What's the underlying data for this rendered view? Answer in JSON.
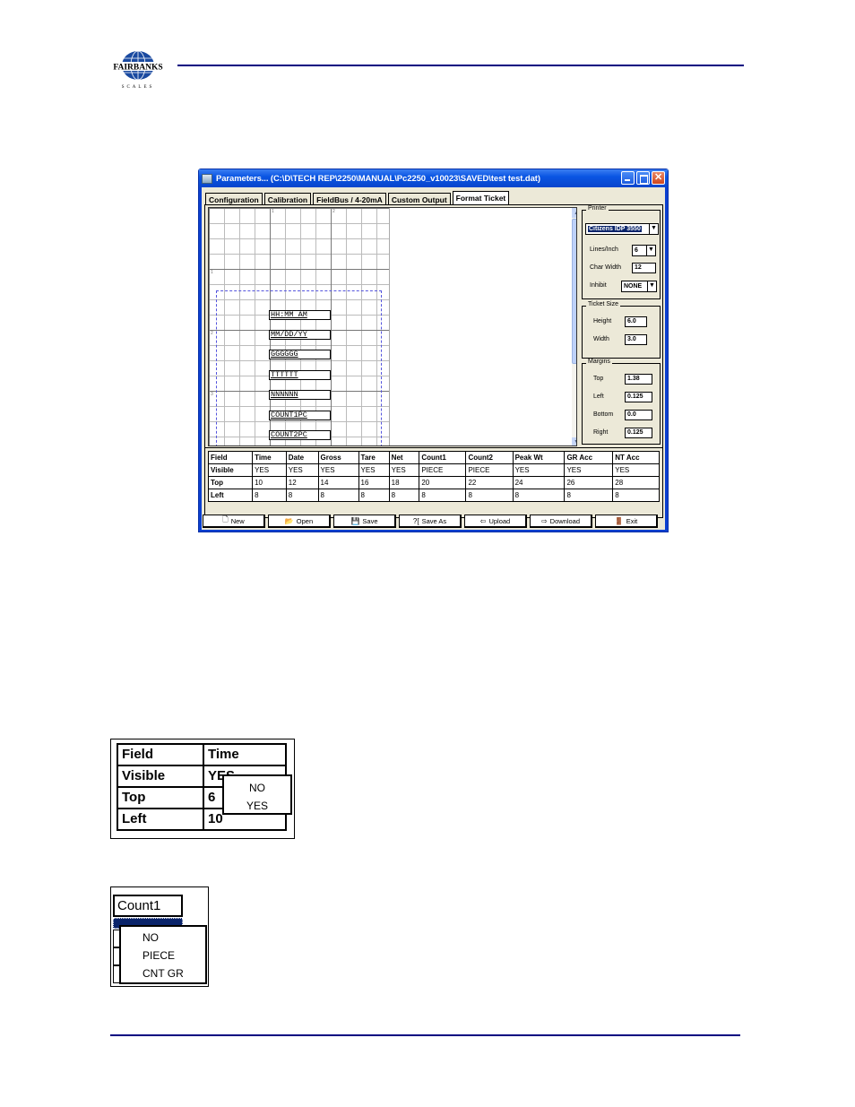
{
  "document": {
    "logo": {
      "brand": "FAIRBANKS",
      "sub": "SCALES"
    },
    "accent_color": "#000080"
  },
  "window": {
    "title": "Parameters... (C:\\D\\TECH REP\\2250\\MANUAL\\Pc2250_v10023\\SAVED\\test test.dat)",
    "controls": [
      "minimize",
      "maximize",
      "close"
    ],
    "tabs": [
      {
        "label": "Configuration",
        "active": false
      },
      {
        "label": "Calibration",
        "active": false
      },
      {
        "label": "FieldBus / 4-20mA",
        "active": false
      },
      {
        "label": "Custom Output",
        "active": false
      },
      {
        "label": "Format Ticket",
        "active": true
      }
    ],
    "canvas": {
      "ruler_top": [
        "1",
        "2"
      ],
      "ruler_left": [
        "1",
        "2",
        "3"
      ],
      "fields": [
        "HH:MM AM",
        "MM/DD/YY",
        "GGGGGG",
        "TTTTTT",
        "NNNNNN",
        "COUNT1PC",
        "COUNT2PC"
      ]
    },
    "printer": {
      "group_label": "Printer",
      "model": "Citizens IDP 3550",
      "lines_per_inch_label": "Lines/Inch",
      "lines_per_inch": "6",
      "char_width_label": "Char Width",
      "char_width": "12",
      "inhibit_label": "Inhibit",
      "inhibit": "NONE"
    },
    "ticket_size": {
      "group_label": "Ticket Size",
      "height_label": "Height",
      "height": "6.0",
      "width_label": "Width",
      "width": "3.0"
    },
    "margins": {
      "group_label": "Margins",
      "top_label": "Top",
      "top": "1.38",
      "left_label": "Left",
      "left": "0.125",
      "bottom_label": "Bottom",
      "bottom": "0.0",
      "right_label": "Right",
      "right": "0.125"
    },
    "field_table": {
      "row_headers": [
        "Field",
        "Visible",
        "Top",
        "Left"
      ],
      "columns": [
        {
          "field": "Time",
          "visible": "YES",
          "top": "10",
          "left": "8"
        },
        {
          "field": "Date",
          "visible": "YES",
          "top": "12",
          "left": "8"
        },
        {
          "field": "Gross",
          "visible": "YES",
          "top": "14",
          "left": "8"
        },
        {
          "field": "Tare",
          "visible": "YES",
          "top": "16",
          "left": "8"
        },
        {
          "field": "Net",
          "visible": "YES",
          "top": "18",
          "left": "8"
        },
        {
          "field": "Count1",
          "visible": "PIECE",
          "top": "20",
          "left": "8"
        },
        {
          "field": "Count2",
          "visible": "PIECE",
          "top": "22",
          "left": "8"
        },
        {
          "field": "Peak Wt",
          "visible": "YES",
          "top": "24",
          "left": "8"
        },
        {
          "field": "GR Acc",
          "visible": "YES",
          "top": "26",
          "left": "8"
        },
        {
          "field": "NT Acc",
          "visible": "YES",
          "top": "28",
          "left": "8"
        }
      ]
    },
    "buttons": [
      {
        "label": "New",
        "icon": "new-document-icon",
        "glyph": "🗋"
      },
      {
        "label": "Open",
        "icon": "folder-open-icon",
        "glyph": "📂"
      },
      {
        "label": "Save",
        "icon": "save-icon",
        "glyph": "💾"
      },
      {
        "label": "Save As",
        "icon": "save-as-icon",
        "glyph": "?["
      },
      {
        "label": "Upload",
        "icon": "upload-icon",
        "glyph": "⇦"
      },
      {
        "label": "Download",
        "icon": "download-icon",
        "glyph": "⇨"
      },
      {
        "label": "Exit",
        "icon": "exit-door-icon",
        "glyph": "🚪"
      }
    ]
  },
  "snippet_visible": {
    "rows": [
      {
        "header": "Field",
        "value": "Time"
      },
      {
        "header": "Visible",
        "value": "YES"
      },
      {
        "header": "Top",
        "value": "6"
      },
      {
        "header": "Left",
        "value": "10"
      }
    ],
    "dropdown_options": [
      "NO",
      "YES"
    ]
  },
  "snippet_count": {
    "header": "Count1",
    "dropdown_options": [
      "NO",
      "PIECE",
      "CNT GR"
    ]
  }
}
